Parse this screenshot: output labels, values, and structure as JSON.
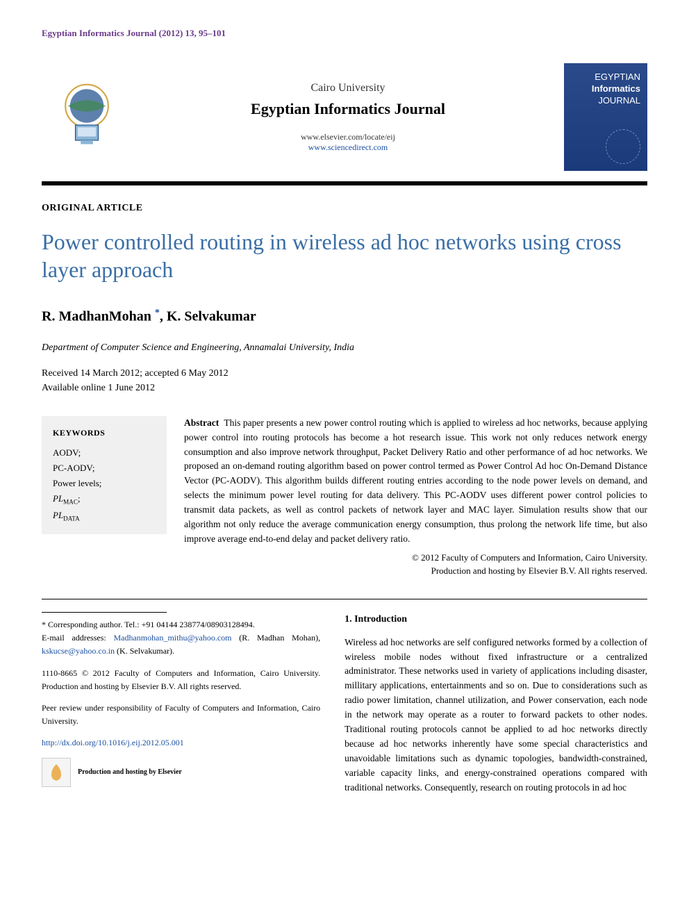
{
  "citation": "Egyptian Informatics Journal (2012) 13, 95–101",
  "masthead": {
    "university": "Cairo University",
    "journal": "Egyptian Informatics Journal",
    "link1": "www.elsevier.com/locate/eij",
    "link2": "www.sciencedirect.com",
    "cover_line1": "EGYPTIAN",
    "cover_line2": "Informatics",
    "cover_line3": "JOURNAL"
  },
  "article_type": "ORIGINAL ARTICLE",
  "title": "Power controlled routing in wireless ad hoc networks using cross layer approach",
  "authors": {
    "a1": "R. MadhanMohan",
    "corr": "*",
    "sep": ", ",
    "a2": "K. Selvakumar"
  },
  "affiliation": "Department of Computer Science and Engineering, Annamalai University, India",
  "dates": {
    "line1": "Received 14 March 2012; accepted 6 May 2012",
    "line2": "Available online 1 June 2012"
  },
  "keywords": {
    "title": "KEYWORDS",
    "items": [
      "AODV;",
      "PC-AODV;",
      "Power levels;",
      "PL",
      "PL"
    ],
    "subs": [
      "MAC",
      "DATA"
    ]
  },
  "abstract": {
    "label": "Abstract",
    "text": "This paper presents a new power control routing which is applied to wireless ad hoc networks, because applying power control into routing protocols has become a hot research issue. This work not only reduces network energy consumption and also improve network throughput, Packet Delivery Ratio and other performance of ad hoc networks. We proposed an on-demand routing algorithm based on power control termed as Power Control Ad hoc On-Demand Distance Vector (PC-AODV). This algorithm builds different routing entries according to the node power levels on demand, and selects the minimum power level routing for data delivery. This PC-AODV uses different power control policies to transmit data packets, as well as control packets of network layer and MAC layer. Simulation results show that our algorithm not only reduce the average communication energy consumption, thus prolong the network life time, but also improve average end-to-end delay and packet delivery ratio."
  },
  "copyright": {
    "line1": "© 2012 Faculty of Computers and Information, Cairo University.",
    "line2": "Production and hosting by Elsevier B.V. All rights reserved."
  },
  "footer": {
    "corresponding_label": "* Corresponding author. Tel.: +91 04144 238774/08903128494.",
    "emails_label": "E-mail addresses: ",
    "email1": "Madhanmohan_mithu@yahoo.com",
    "email1_name": " (R. Madhan Mohan), ",
    "email2": "kskucse@yahoo.co.in",
    "email2_name": " (K. Selvakumar).",
    "issn_block": "1110-8665 © 2012 Faculty of Computers and Information, Cairo University. Production and hosting by Elsevier B.V. All rights reserved.",
    "peer_review": "Peer review under responsibility of Faculty of Computers and Information, Cairo University.",
    "doi": "http://dx.doi.org/10.1016/j.eij.2012.05.001",
    "elsevier_label": "ELSEVIER",
    "production_hosting": "Production and hosting by Elsevier"
  },
  "intro": {
    "heading": "1. Introduction",
    "text": "Wireless ad hoc networks are self configured networks formed by a collection of wireless mobile nodes without fixed infrastructure or a centralized administrator. These networks used in variety of applications including disaster, millitary applications, entertainments and so on. Due to considerations such as radio power limitation, channel utilization, and Power conservation, each node in the network may operate as a router to forward packets to other nodes. Traditional routing protocols cannot be applied to ad hoc networks directly because ad hoc networks inherently have some special characteristics and unavoidable limitations such as dynamic topologies, bandwidth-constrained, variable capacity links, and energy-constrained operations compared with traditional networks. Consequently, research on routing protocols in ad hoc"
  }
}
